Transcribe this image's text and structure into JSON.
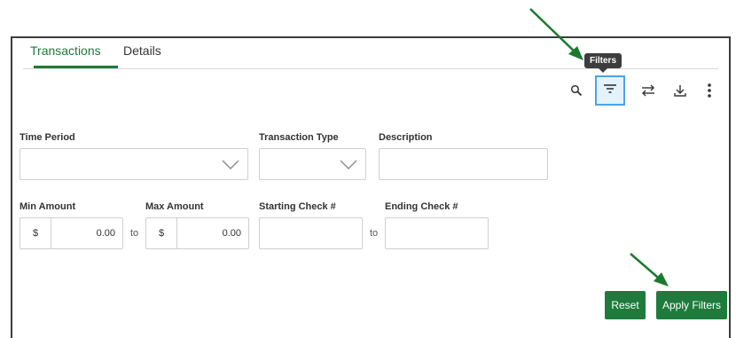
{
  "tabs": [
    {
      "label": "Transactions",
      "active": true
    },
    {
      "label": "Details",
      "active": false
    }
  ],
  "toolbar": {
    "tooltip": "Filters",
    "icons": [
      "search-icon",
      "filter-icon",
      "swap-icon",
      "download-icon",
      "more-icon"
    ]
  },
  "filters": {
    "time_period": {
      "label": "Time Period",
      "value": ""
    },
    "transaction_type": {
      "label": "Transaction Type",
      "value": ""
    },
    "description": {
      "label": "Description",
      "value": ""
    },
    "min_amount": {
      "label": "Min Amount",
      "currency": "$",
      "value": "0.00"
    },
    "max_amount": {
      "label": "Max Amount",
      "currency": "$",
      "value": "0.00"
    },
    "amount_to": "to",
    "starting_check": {
      "label": "Starting Check #",
      "value": ""
    },
    "ending_check": {
      "label": "Ending Check #",
      "value": ""
    },
    "check_to": "to"
  },
  "buttons": {
    "reset": "Reset",
    "apply": "Apply Filters"
  },
  "colors": {
    "accent": "#1f7a3a",
    "button": "#1e7b3c",
    "annotation_arrow": "#1a7a2e",
    "focus": "#4aa3e8"
  }
}
